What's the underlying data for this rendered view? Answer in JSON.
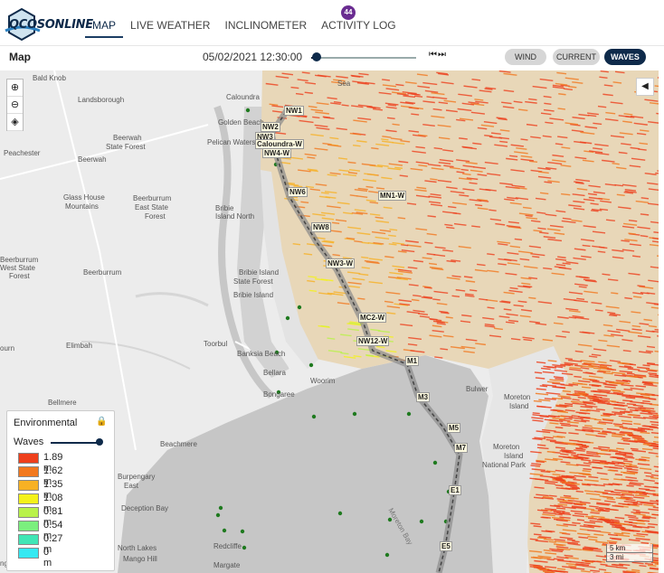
{
  "header": {
    "logo_text": "QCOSONLINE",
    "tabs": [
      {
        "label": "MAP"
      },
      {
        "label": "LIVE WEATHER"
      },
      {
        "label": "INCLINOMETER"
      },
      {
        "label": "ACTIVITY LOG"
      }
    ],
    "activity_badge": "44"
  },
  "toolbar": {
    "title": "Map",
    "datetime": "05/02/2021 12:30:00",
    "slider_value": 0.05,
    "modes": [
      {
        "label": "WIND"
      },
      {
        "label": "CURRENT"
      },
      {
        "label": "WAVES"
      }
    ],
    "active_mode": "WAVES"
  },
  "map": {
    "zoom_in": "+",
    "zoom_out": "−",
    "collapse_icon": "◀",
    "places": [
      {
        "name": "Bald Knob"
      },
      {
        "name": "Landsborough"
      },
      {
        "name": "Caloundra"
      },
      {
        "name": "Golden Beach"
      },
      {
        "name": "Pelican Waters"
      },
      {
        "name": "Beerwah"
      },
      {
        "name": "State Forest"
      },
      {
        "name": "Peachester"
      },
      {
        "name": "Beerwah"
      },
      {
        "name": "Glass House"
      },
      {
        "name": "Mountains"
      },
      {
        "name": "Beerburrum"
      },
      {
        "name": "East State"
      },
      {
        "name": "Forest"
      },
      {
        "name": "Bribie"
      },
      {
        "name": "Island North"
      },
      {
        "name": "Beerburrum"
      },
      {
        "name": "West State"
      },
      {
        "name": "Forest"
      },
      {
        "name": "Beerburrum"
      },
      {
        "name": "Bribie Island"
      },
      {
        "name": "State Forest"
      },
      {
        "name": "Bribie Island"
      },
      {
        "name": "Elimbah"
      },
      {
        "name": "Toorbul"
      },
      {
        "name": "Banksia Beach"
      },
      {
        "name": "Bellara"
      },
      {
        "name": "Bongaree"
      },
      {
        "name": "Woorim"
      },
      {
        "name": "Bellmere"
      },
      {
        "name": "Beachmere"
      },
      {
        "name": "Burpengary"
      },
      {
        "name": "East"
      },
      {
        "name": "Deception Bay"
      },
      {
        "name": "North Lakes"
      },
      {
        "name": "Mango Hill"
      },
      {
        "name": "Redcliffe"
      },
      {
        "name": "Margate"
      },
      {
        "name": "Bulwer"
      },
      {
        "name": "Moreton"
      },
      {
        "name": "Island"
      },
      {
        "name": "Moreton"
      },
      {
        "name": "Island"
      },
      {
        "name": "National Park"
      },
      {
        "name": "Sea"
      },
      {
        "name": "Moreton Bay"
      },
      {
        "name": "ourn"
      },
      {
        "name": "ngara"
      }
    ],
    "stations": [
      {
        "label": "NW1"
      },
      {
        "label": "NW2"
      },
      {
        "label": "NW3"
      },
      {
        "label": "Caloundra-W"
      },
      {
        "label": "NW4-W"
      },
      {
        "label": "NW6"
      },
      {
        "label": "MN1-W"
      },
      {
        "label": "NW8"
      },
      {
        "label": "NW3-W"
      },
      {
        "label": "MC2-W"
      },
      {
        "label": "NW12-W"
      },
      {
        "label": "M1"
      },
      {
        "label": "M3"
      },
      {
        "label": "M5"
      },
      {
        "label": "M7"
      },
      {
        "label": "E1"
      },
      {
        "label": "E5"
      }
    ],
    "scale": {
      "km": "5 km",
      "mi": "3 mi"
    }
  },
  "legend": {
    "title": "Environmental",
    "lock_icon": "lock-icon",
    "layer_label": "Waves",
    "items": [
      {
        "label": "1.89 m",
        "color": "#ee3f1c"
      },
      {
        "label": "1.62 m",
        "color": "#f2781e"
      },
      {
        "label": "1.35 m",
        "color": "#f7b124"
      },
      {
        "label": "1.08 m",
        "color": "#f4f21a"
      },
      {
        "label": "0.81 m",
        "color": "#b9f24a"
      },
      {
        "label": "0.54 m",
        "color": "#7bef7e"
      },
      {
        "label": "0.27 m",
        "color": "#41e6b6"
      },
      {
        "label": "0 m",
        "color": "#35e9f2"
      }
    ]
  }
}
